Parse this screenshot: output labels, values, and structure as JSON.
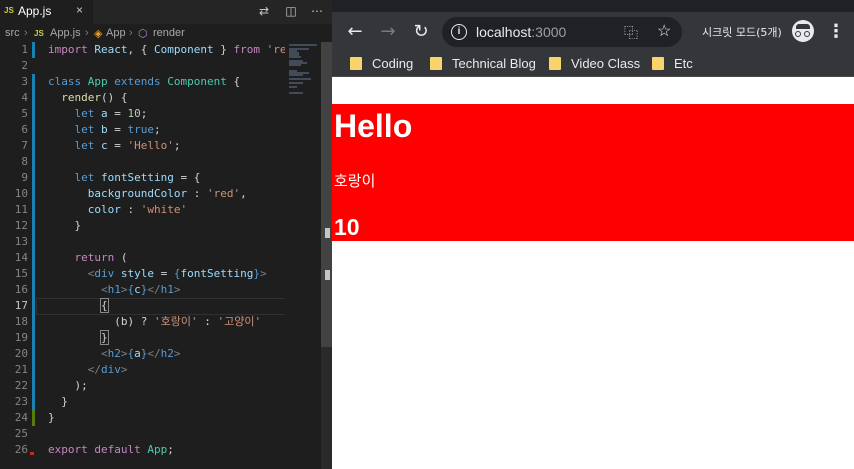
{
  "editor": {
    "tab": {
      "icon": "JS",
      "filename": "App.js",
      "close": "×"
    },
    "breadcrumb": {
      "folder": "src",
      "sep": ">",
      "file_icon": "JS",
      "file": "App.js",
      "class": "App",
      "method": "render"
    },
    "code_lines": [
      "import React, { Component } from 'react';",
      "",
      "class App extends Component {",
      "  render() {",
      "    let a = 10;",
      "    let b = true;",
      "    let c = 'Hello';",
      "",
      "    let fontSetting = {",
      "      backgroundColor : 'red',",
      "      color : 'white'",
      "    }",
      "",
      "    return (",
      "      <div style = {fontSetting}>",
      "        <h1>{c}</h1>",
      "        {",
      "          (b) ? '호랑이' : '고양이'",
      "        }",
      "        <h2>{a}</h2>",
      "      </div>",
      "    );",
      "  }",
      "}",
      "",
      "export default App;"
    ],
    "line_numbers": [
      "1",
      "2",
      "3",
      "4",
      "5",
      "6",
      "7",
      "8",
      "9",
      "10",
      "11",
      "12",
      "13",
      "14",
      "15",
      "16",
      "17",
      "18",
      "19",
      "20",
      "21",
      "22",
      "23",
      "24",
      "25",
      "26"
    ],
    "current_line": 17
  },
  "browser": {
    "toolbar": {
      "back_icon": "arrow-left-icon",
      "forward_icon": "arrow-right-icon",
      "reload_icon": "reload-icon",
      "url_host": "localhost",
      "url_port": ":3000",
      "incognito_label": "시크릿 모드(5개)"
    },
    "bookmarks": [
      "Coding",
      "Technical Blog",
      "Video Class",
      "Etc"
    ],
    "page": {
      "h1": "Hello",
      "paragraph": "호랑이",
      "h2": "10",
      "background_color": "#ff0000",
      "text_color": "#ffffff"
    }
  }
}
